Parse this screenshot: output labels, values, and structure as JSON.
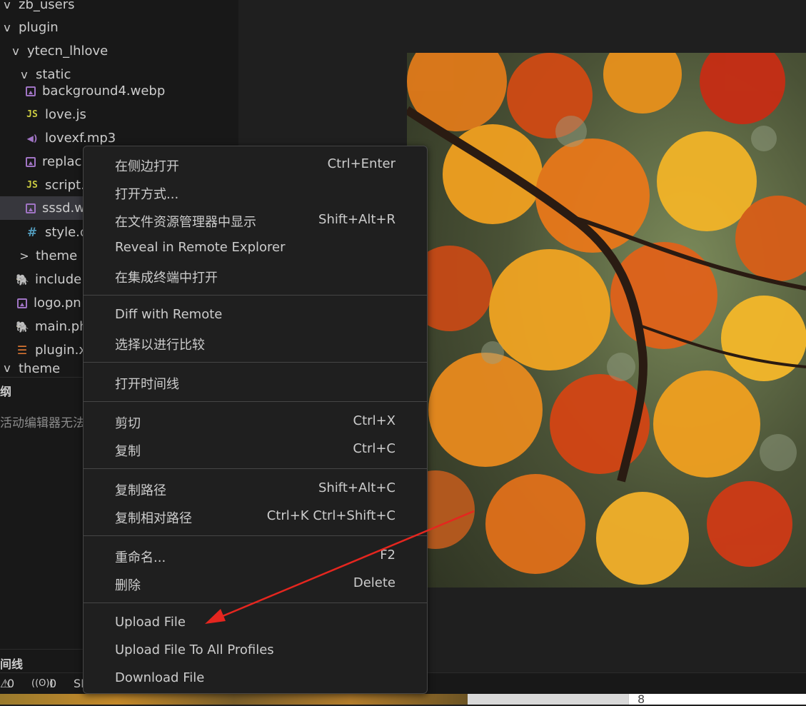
{
  "explorer": {
    "items": [
      {
        "label": "zb_users",
        "chevron": "v",
        "icon": "folder-open"
      },
      {
        "label": "plugin",
        "chevron": "v",
        "icon": "folder-open"
      },
      {
        "label": "ytecn_lhlove",
        "chevron": "v",
        "icon": "folder-open"
      },
      {
        "label": "static",
        "chevron": "v",
        "icon": "folder-open"
      },
      {
        "label": "background4.webp",
        "icon": "image-file-icon"
      },
      {
        "label": "love.js",
        "icon": "js-file-icon",
        "icon_text": "JS"
      },
      {
        "label": "lovexf.mp3",
        "icon": "audio-file-icon",
        "icon_text": "◀)"
      },
      {
        "label": "replac",
        "icon": "image-file-icon"
      },
      {
        "label": "script.",
        "icon": "js-file-icon",
        "icon_text": "JS"
      },
      {
        "label": "sssd.w",
        "icon": "image-file-icon",
        "selected": true
      },
      {
        "label": "style.c",
        "icon": "css-file-icon",
        "icon_text": "#"
      },
      {
        "label": "theme",
        "chevron": ">",
        "icon": "folder-closed"
      },
      {
        "label": "include.",
        "icon": "php-file-icon",
        "icon_text": "🐘"
      },
      {
        "label": "logo.pn",
        "icon": "image-file-icon"
      },
      {
        "label": "main.ph",
        "icon": "php-file-icon",
        "icon_text": "🐘"
      },
      {
        "label": "plugin.x",
        "icon": "xml-file-icon",
        "icon_text": "☰"
      },
      {
        "label": "theme",
        "chevron": "v",
        "icon": "folder-open"
      }
    ]
  },
  "outline": {
    "header": "纲",
    "message": "活动编辑器无法"
  },
  "timeline": {
    "header": "间线"
  },
  "statusbar": {
    "warnings": "0",
    "ports": "0",
    "partial": "SI",
    "warning_glyph": "⚠",
    "ports_glyph": "((ʘ))"
  },
  "bottom_strip": {
    "page_number": "8"
  },
  "context_menu": {
    "groups": [
      [
        {
          "label": "在侧边打开",
          "shortcut": "Ctrl+Enter"
        },
        {
          "label": "打开方式...",
          "shortcut": ""
        },
        {
          "label": "在文件资源管理器中显示",
          "shortcut": "Shift+Alt+R"
        },
        {
          "label": "Reveal in Remote Explorer",
          "shortcut": ""
        },
        {
          "label": "在集成终端中打开",
          "shortcut": ""
        }
      ],
      [
        {
          "label": "Diff with Remote",
          "shortcut": ""
        },
        {
          "label": "选择以进行比较",
          "shortcut": ""
        }
      ],
      [
        {
          "label": "打开时间线",
          "shortcut": ""
        }
      ],
      [
        {
          "label": "剪切",
          "shortcut": "Ctrl+X"
        },
        {
          "label": "复制",
          "shortcut": "Ctrl+C"
        }
      ],
      [
        {
          "label": "复制路径",
          "shortcut": "Shift+Alt+C"
        },
        {
          "label": "复制相对路径",
          "shortcut": "Ctrl+K Ctrl+Shift+C"
        }
      ],
      [
        {
          "label": "重命名...",
          "shortcut": "F2"
        },
        {
          "label": "删除",
          "shortcut": "Delete"
        }
      ],
      [
        {
          "label": "Upload File",
          "shortcut": ""
        },
        {
          "label": "Upload File To All Profiles",
          "shortcut": ""
        },
        {
          "label": "Download File",
          "shortcut": ""
        }
      ]
    ]
  },
  "annotation": {
    "arrow_color": "#e5261f"
  },
  "colors": {
    "sidebar_bg": "#181818",
    "editor_bg": "#1f1f1f",
    "menu_border": "#454545",
    "selected_row": "#37373d"
  }
}
